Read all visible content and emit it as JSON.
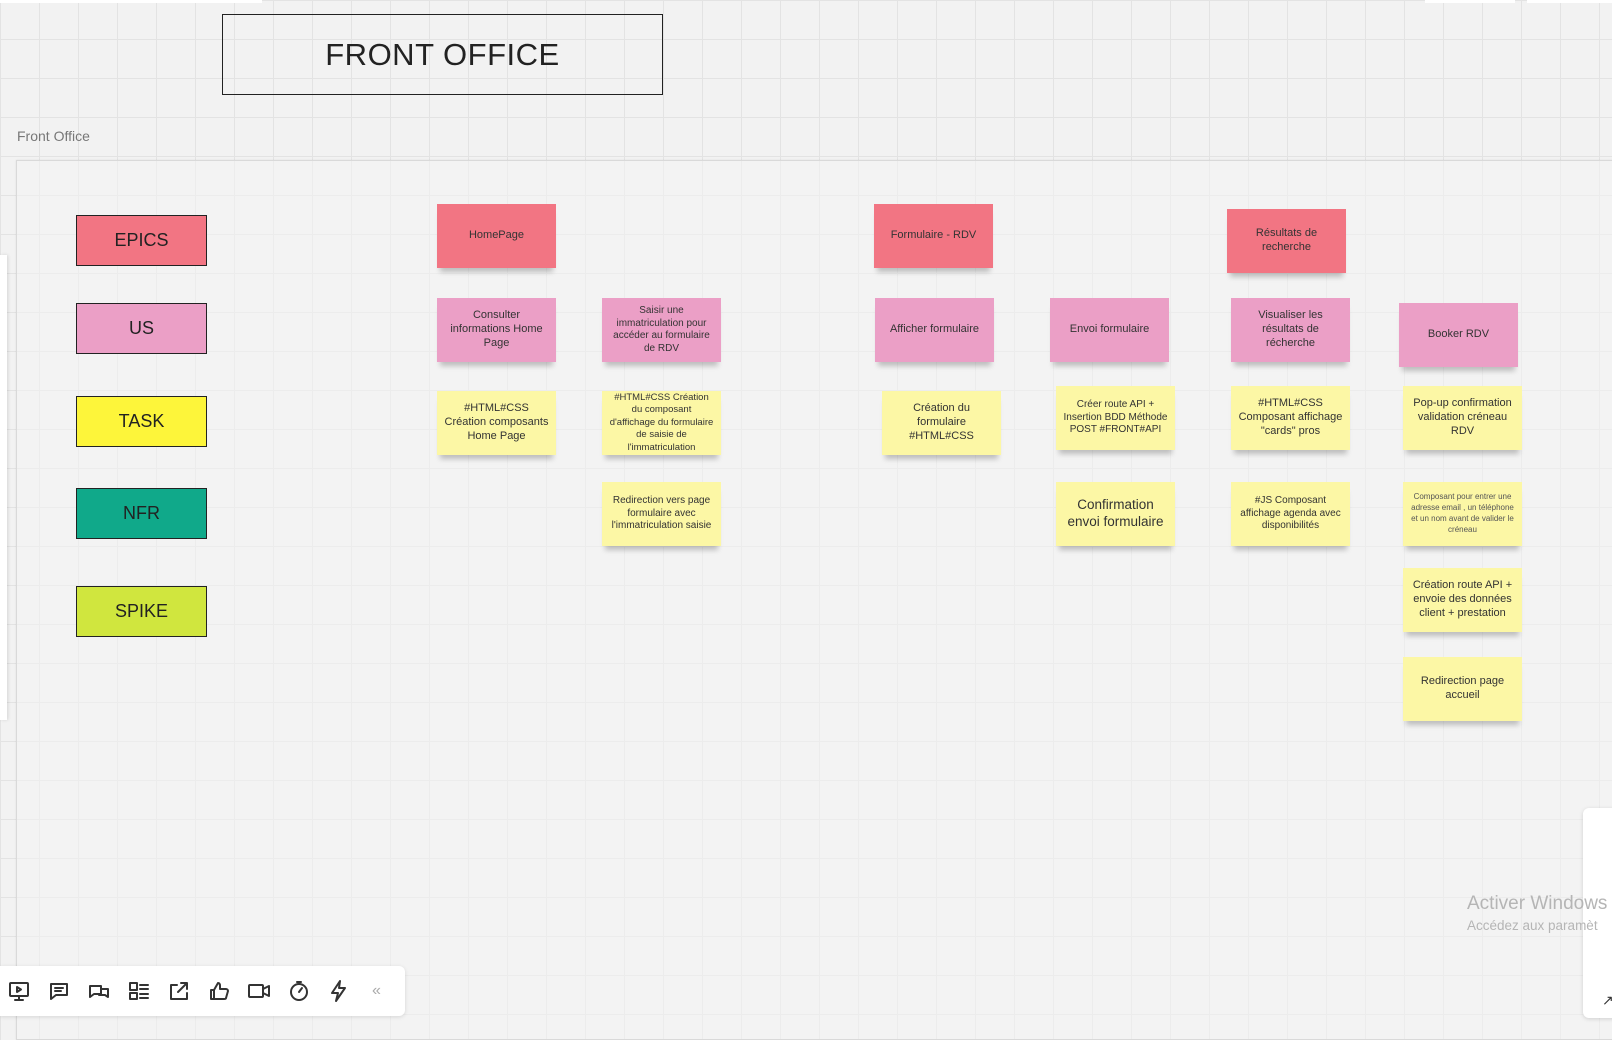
{
  "board": {
    "title": "FRONT OFFICE",
    "frame_label": "Front Office"
  },
  "colors": {
    "epic": "#f27583",
    "us": "#eb9fc6",
    "task": "#fcf7a5",
    "nfr": "#10a98a",
    "spike": "#d0e63e",
    "legend_epic": "#f27583",
    "legend_us": "#eb9fc6",
    "legend_task": "#fdf53a"
  },
  "legend": {
    "epics": "EPICS",
    "us": "US",
    "task": "TASK",
    "nfr": "NFR",
    "spike": "SPIKE"
  },
  "epics": {
    "homepage": "HomePage",
    "formulaire_rdv": "Formulaire - RDV",
    "resultats": "Résultats de recherche"
  },
  "user_stories": {
    "consulter": "Consulter informations Home Page",
    "saisir": "Saisir une immatriculation pour accéder au formulaire de RDV",
    "afficher": "Afficher formulaire",
    "envoi": "Envoi formulaire",
    "visualiser": "Visualiser les résultats de récherche",
    "booker": "Booker RDV"
  },
  "tasks": {
    "html_css_home": "#HTML#CSS Création composants Home Page",
    "html_css_immat": "#HTML#CSS Création du composant d'affichage du formulaire de saisie de l'immatriculation",
    "redirection_formulaire": "Redirection vers page formulaire avec l'immatriculation saisie",
    "creation_formulaire": "Création du formulaire #HTML#CSS",
    "creer_route": "Créer route API + Insertion BDD Méthode POST #FRONT#API",
    "confirmation": "Confirmation envoi formulaire",
    "cards": "#HTML#CSS Composant affichage \"cards\" pros",
    "agenda": "#JS Composant affichage agenda avec disponibilités",
    "popup": "Pop-up confirmation validation créneau RDV",
    "composant_email": "Composant pour entrer une adresse email , un téléphone et un nom avant de valider le créneau",
    "creation_route_client": "Création route API + envoie des données client + prestation",
    "redirection_accueil": "Redirection page accueil"
  },
  "toolbar": {
    "icons": [
      "present-icon",
      "comment-icon",
      "chat-icon",
      "cards-icon",
      "share-icon",
      "vote-icon",
      "video-icon",
      "timer-icon",
      "bolt-icon"
    ],
    "collapse": "«"
  },
  "watermark": {
    "line1": "Activer Windows",
    "line2": "Accédez aux paramèt"
  }
}
